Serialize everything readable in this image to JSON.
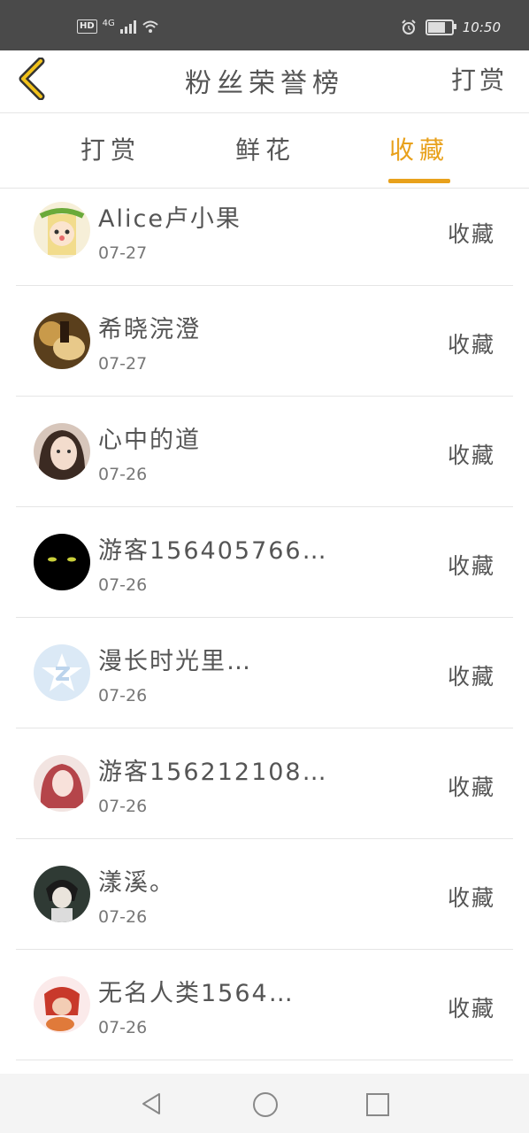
{
  "status_bar": {
    "hd": "HD",
    "network": "4G",
    "time": "10:50"
  },
  "header": {
    "title": "粉丝荣誉榜",
    "right_action": "打赏"
  },
  "tabs": [
    {
      "label": "打赏"
    },
    {
      "label": "鲜花"
    },
    {
      "label": "收藏"
    }
  ],
  "active_tab": "收藏",
  "accent_color": "#e8a11c",
  "fans": [
    {
      "name": "Alice卢小果",
      "date": "07-27",
      "action": "收藏"
    },
    {
      "name": "希晓浣澄",
      "date": "07-27",
      "action": "收藏"
    },
    {
      "name": "心中的道",
      "date": "07-26",
      "action": "收藏"
    },
    {
      "name": "游客156405766…",
      "date": "07-26",
      "action": "收藏"
    },
    {
      "name": "漫长时光里…",
      "date": "07-26",
      "action": "收藏"
    },
    {
      "name": "游客156212108…",
      "date": "07-26",
      "action": "收藏"
    },
    {
      "name": "漾溪。",
      "date": "07-26",
      "action": "收藏"
    },
    {
      "name": "无名人类1564…",
      "date": "07-26",
      "action": "收藏"
    }
  ]
}
